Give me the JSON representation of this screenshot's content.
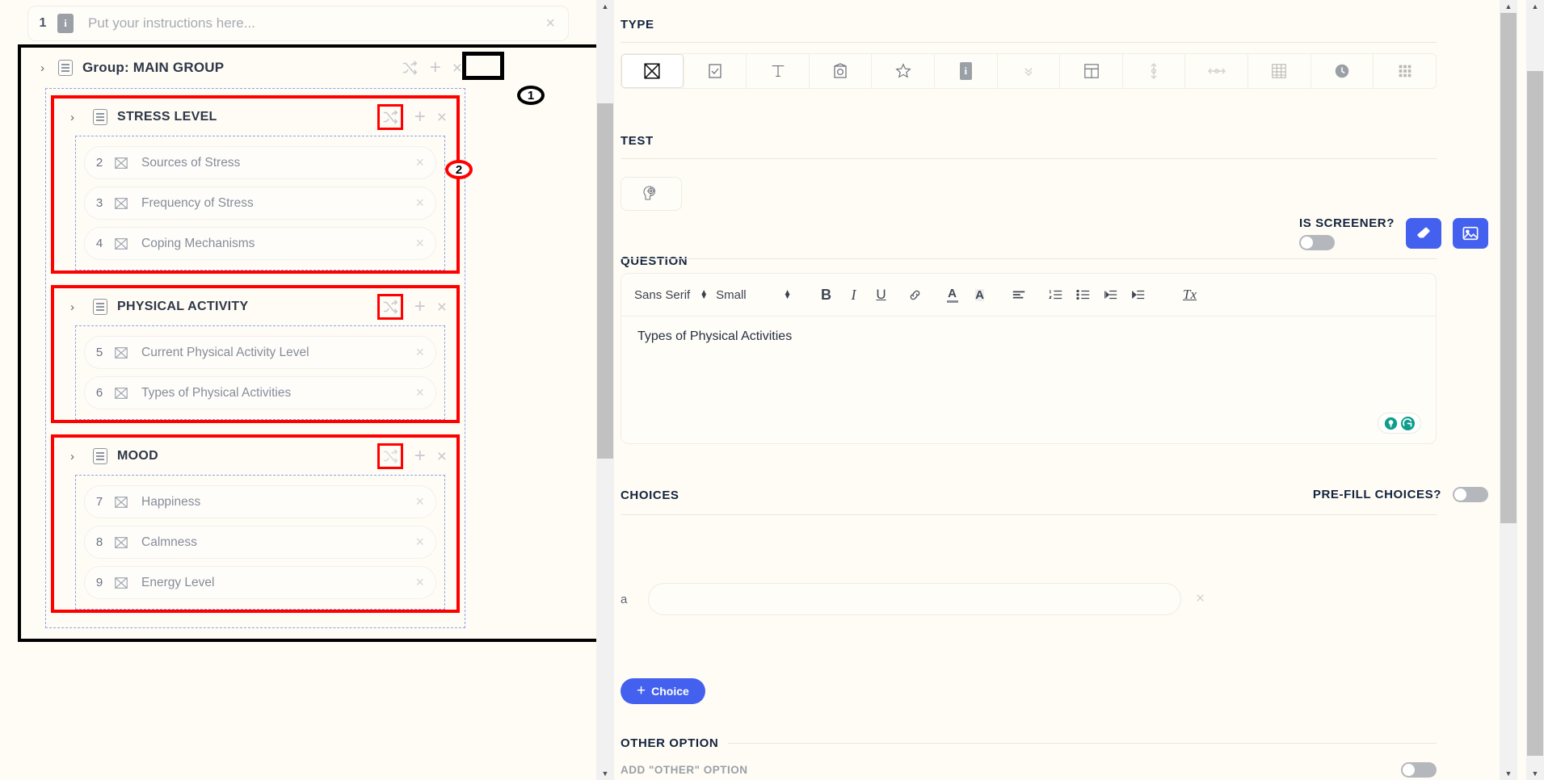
{
  "left": {
    "instruction": {
      "number": "1",
      "placeholder": "Put your instructions here...",
      "icon": "info-icon",
      "close": "×"
    },
    "group": {
      "title": "Group: MAIN GROUP",
      "caret": "›",
      "shuffle_icon": "shuffle-icon",
      "plus": "+",
      "close": "×"
    },
    "callouts": [
      {
        "id": "1"
      },
      {
        "id": "2"
      }
    ],
    "sections": [
      {
        "title": "STRESS LEVEL",
        "highlighted": true,
        "questions": [
          {
            "num": "2",
            "label": "Sources of Stress",
            "type_icon": "multiple-choice-icon"
          },
          {
            "num": "3",
            "label": "Frequency of Stress",
            "type_icon": "multiple-choice-icon"
          },
          {
            "num": "4",
            "label": "Coping Mechanisms",
            "type_icon": "multiple-choice-icon"
          }
        ]
      },
      {
        "title": "PHYSICAL ACTIVITY",
        "highlighted": true,
        "questions": [
          {
            "num": "5",
            "label": "Current Physical Activity Level",
            "type_icon": "multiple-choice-icon"
          },
          {
            "num": "6",
            "label": "Types of Physical Activities",
            "type_icon": "multiple-choice-icon"
          }
        ]
      },
      {
        "title": "MOOD",
        "highlighted": true,
        "questions": [
          {
            "num": "7",
            "label": "Happiness",
            "type_icon": "multiple-choice-icon"
          },
          {
            "num": "8",
            "label": "Calmness",
            "type_icon": "multiple-choice-icon"
          },
          {
            "num": "9",
            "label": "Energy Level",
            "type_icon": "multiple-choice-icon"
          }
        ]
      }
    ]
  },
  "right": {
    "type": {
      "label": "TYPE",
      "options": [
        {
          "icon": "multiple-choice-icon",
          "selected": true
        },
        {
          "icon": "checkbox-icon",
          "selected": false
        },
        {
          "icon": "text-icon",
          "selected": false
        },
        {
          "icon": "camera-icon",
          "selected": false
        },
        {
          "icon": "star-rating-icon",
          "selected": false
        },
        {
          "icon": "info-icon",
          "selected": false
        },
        {
          "icon": "chevron-double-down-icon",
          "selected": false
        },
        {
          "icon": "layout-grid-icon",
          "selected": false
        },
        {
          "icon": "vertical-slider-icon",
          "selected": false
        },
        {
          "icon": "horizontal-slider-icon",
          "selected": false
        },
        {
          "icon": "spreadsheet-icon",
          "selected": false
        },
        {
          "icon": "clock-icon",
          "selected": false
        },
        {
          "icon": "grid-dots-icon",
          "selected": false
        }
      ]
    },
    "test": {
      "label": "TEST",
      "icon": "brain-head-icon"
    },
    "question": {
      "label": "QUESTION",
      "is_screener_label": "IS SCREENER?",
      "is_screener_on": false,
      "eraser_icon": "eraser-icon",
      "image_icon": "image-icon",
      "toolbar": {
        "font_family": "Sans Serif",
        "font_size": "Small",
        "bold": "B",
        "italic": "I",
        "underline": "U",
        "link": "link-icon",
        "text_color": "A",
        "highlight_color": "A",
        "align": "align-icon",
        "ordered_list": "ordered-list-icon",
        "bullet_list": "bullet-list-icon",
        "outdent": "outdent-icon",
        "indent": "indent-icon",
        "clear_format": "Tx"
      },
      "text": "Types of Physical Activities",
      "grammarly": {
        "lightbulb_icon": "lightbulb-icon",
        "logo_icon": "grammarly-logo-icon"
      }
    },
    "choices": {
      "label": "CHOICES",
      "prefill_label": "PRE-FILL CHOICES?",
      "prefill_on": false,
      "items": [
        {
          "key": "a",
          "value": "",
          "close": "×"
        }
      ],
      "add_button": "Choice",
      "add_plus": "+"
    },
    "other_option": {
      "label": "OTHER OPTION",
      "add_other_label": "ADD \"OTHER\" OPTION",
      "add_other_on": false
    }
  },
  "colors": {
    "accent_blue": "#4361ee",
    "highlight_red": "#ff0000",
    "bg": "#fffcf5",
    "dashed_blue": "#8aa4e8"
  }
}
